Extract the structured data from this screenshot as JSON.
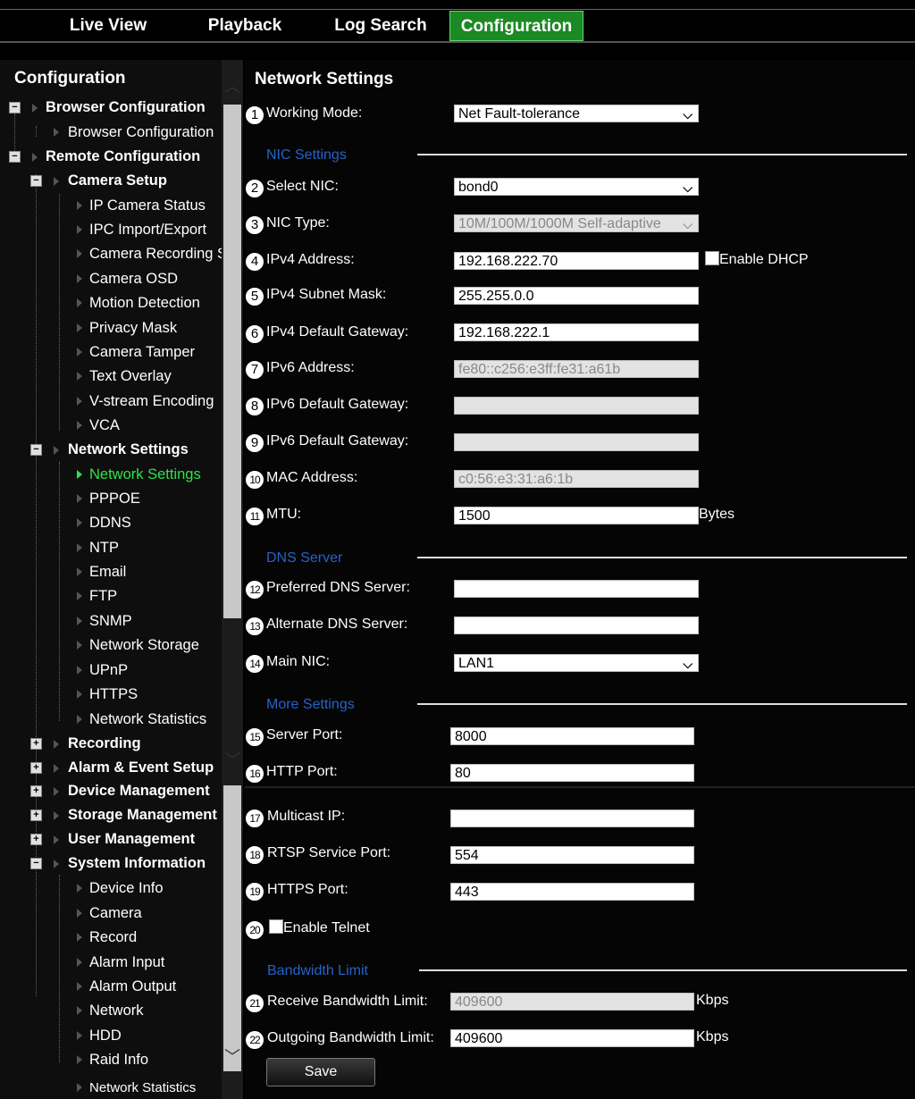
{
  "tabs": [
    {
      "label": "Live View"
    },
    {
      "label": "Playback"
    },
    {
      "label": "Log Search"
    },
    {
      "label": "Configuration"
    }
  ],
  "sidebar": {
    "title": "Configuration",
    "items": [
      {
        "label": "Browser Configuration"
      },
      {
        "label": "Browser Configuration"
      },
      {
        "label": "Remote Configuration"
      },
      {
        "label": "Camera Setup"
      },
      {
        "label": "IP Camera Status"
      },
      {
        "label": "IPC Import/Export"
      },
      {
        "label": "Camera Recording S"
      },
      {
        "label": "Camera OSD"
      },
      {
        "label": "Motion Detection"
      },
      {
        "label": "Privacy Mask"
      },
      {
        "label": "Camera Tamper"
      },
      {
        "label": "Text Overlay"
      },
      {
        "label": "V-stream Encoding"
      },
      {
        "label": "VCA"
      },
      {
        "label": "Network Settings"
      },
      {
        "label": "Network Settings"
      },
      {
        "label": "PPPOE"
      },
      {
        "label": "DDNS"
      },
      {
        "label": "NTP"
      },
      {
        "label": "Email"
      },
      {
        "label": "FTP"
      },
      {
        "label": "SNMP"
      },
      {
        "label": "Network Storage"
      },
      {
        "label": "UPnP"
      },
      {
        "label": "HTTPS"
      },
      {
        "label": "Network Statistics"
      },
      {
        "label": "Recording"
      },
      {
        "label": "Alarm & Event Setup"
      },
      {
        "label": "Device Management"
      },
      {
        "label": "Storage Management"
      },
      {
        "label": "User Management"
      },
      {
        "label": "System Information"
      },
      {
        "label": "Device Info"
      },
      {
        "label": "Camera"
      },
      {
        "label": "Record"
      },
      {
        "label": "Alarm Input"
      },
      {
        "label": "Alarm Output"
      },
      {
        "label": "Network"
      },
      {
        "label": "HDD"
      },
      {
        "label": "Raid Info"
      },
      {
        "label": "Network Statistics"
      }
    ]
  },
  "main": {
    "title": "Network Settings",
    "sections": {
      "nic": "NIC Settings",
      "dns": "DNS Server",
      "more": "More Settings",
      "bandwidth": "Bandwidth Limit"
    },
    "rows": [
      {
        "num": "1",
        "label": "Working Mode:",
        "value": "Net Fault-tolerance"
      },
      {
        "num": "2",
        "label": "Select NIC:",
        "value": "bond0"
      },
      {
        "num": "3",
        "label": "NIC Type:",
        "value": "10M/100M/1000M Self-adaptive"
      },
      {
        "num": "4",
        "label": "IPv4 Address:",
        "value": "192.168.222.70",
        "extra": "Enable DHCP"
      },
      {
        "num": "5",
        "label": "IPv4 Subnet Mask:",
        "value": "255.255.0.0"
      },
      {
        "num": "6",
        "label": "IPv4 Default Gateway:",
        "value": "192.168.222.1"
      },
      {
        "num": "7",
        "label": "IPv6 Address:",
        "value": "fe80::c256:e3ff:fe31:a61b"
      },
      {
        "num": "8",
        "label": "IPv6 Default Gateway:",
        "value": ""
      },
      {
        "num": "9",
        "label": "IPv6 Default Gateway:",
        "value": ""
      },
      {
        "num": "10",
        "label": "MAC Address:",
        "value": "c0:56:e3:31:a6:1b"
      },
      {
        "num": "11",
        "label": "MTU:",
        "value": "1500",
        "unit": "Bytes"
      },
      {
        "num": "12",
        "label": "Preferred DNS Server:",
        "value": ""
      },
      {
        "num": "13",
        "label": "Alternate DNS Server:",
        "value": ""
      },
      {
        "num": "14",
        "label": "Main NIC:",
        "value": "LAN1"
      },
      {
        "num": "15",
        "label": "Server Port:",
        "value": "8000"
      },
      {
        "num": "16",
        "label": "HTTP Port:",
        "value": "80"
      },
      {
        "num": "17",
        "label": "Multicast IP:",
        "value": ""
      },
      {
        "num": "18",
        "label": "RTSP Service Port:",
        "value": "554"
      },
      {
        "num": "19",
        "label": "HTTPS Port:",
        "value": "443"
      },
      {
        "num": "20",
        "label": "Enable Telnet"
      },
      {
        "num": "21",
        "label": "Receive Bandwidth Limit:",
        "value": "409600",
        "unit": "Kbps"
      },
      {
        "num": "22",
        "label": "Outgoing Bandwidth Limit:",
        "value": "409600",
        "unit": "Kbps"
      }
    ],
    "save_label": "Save"
  },
  "colors": {
    "active_tab": "#1b8a24",
    "section_heading": "#2563c8",
    "active_tree": "#2ee24a"
  }
}
